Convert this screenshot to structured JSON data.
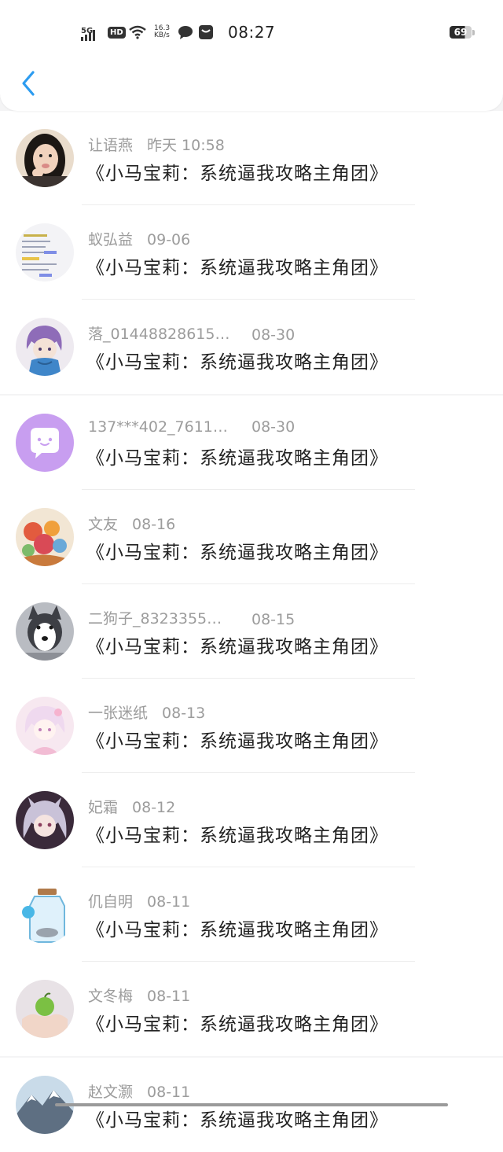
{
  "status_bar": {
    "network": "5G",
    "hd": "HD",
    "speed_value": "16.3",
    "speed_unit": "KB/s",
    "time": "08:27",
    "battery": "69"
  },
  "header": {
    "back_icon": "chevron-left-icon",
    "accent": "#2d9cf0"
  },
  "comments": [
    {
      "name": "让语燕",
      "date": "昨天 10:58",
      "message": "《小马宝莉：系统逼我攻略主角团》",
      "avatar": "photo-girl"
    },
    {
      "name": "蚁弘益",
      "date": "09-06",
      "message": "《小马宝莉：系统逼我攻略主角团》",
      "avatar": "text-screenshot"
    },
    {
      "name": "落_01448828615…",
      "date": "08-30",
      "message": "《小马宝莉：系统逼我攻略主角团》",
      "avatar": "anime-purple-hair"
    },
    {
      "name": "137***402_7611…",
      "date": "08-30",
      "message": "《小马宝莉：系统逼我攻略主角团》",
      "avatar": "default-chat-bubble"
    },
    {
      "name": "文友",
      "date": "08-16",
      "message": "《小马宝莉：系统逼我攻略主角团》",
      "avatar": "floral-art"
    },
    {
      "name": "二狗子_8323355…",
      "date": "08-15",
      "message": "《小马宝莉：系统逼我攻略主角团》",
      "avatar": "husky-dog"
    },
    {
      "name": "一张迷纸",
      "date": "08-13",
      "message": "《小马宝莉：系统逼我攻略主角团》",
      "avatar": "anime-pink"
    },
    {
      "name": "妃霜",
      "date": "08-12",
      "message": "《小马宝莉：系统逼我攻略主角团》",
      "avatar": "anime-silver-hair"
    },
    {
      "name": "仉自明",
      "date": "08-11",
      "message": "《小马宝莉：系统逼我攻略主角团》",
      "avatar": "glass-jar"
    },
    {
      "name": "文冬梅",
      "date": "08-11",
      "message": "《小马宝莉：系统逼我攻略主角团》",
      "avatar": "hands-green-apple"
    },
    {
      "name": "赵文灏",
      "date": "08-11",
      "message": "《小马宝莉：系统逼我攻略主角团》",
      "avatar": "mountain-landscape"
    }
  ]
}
